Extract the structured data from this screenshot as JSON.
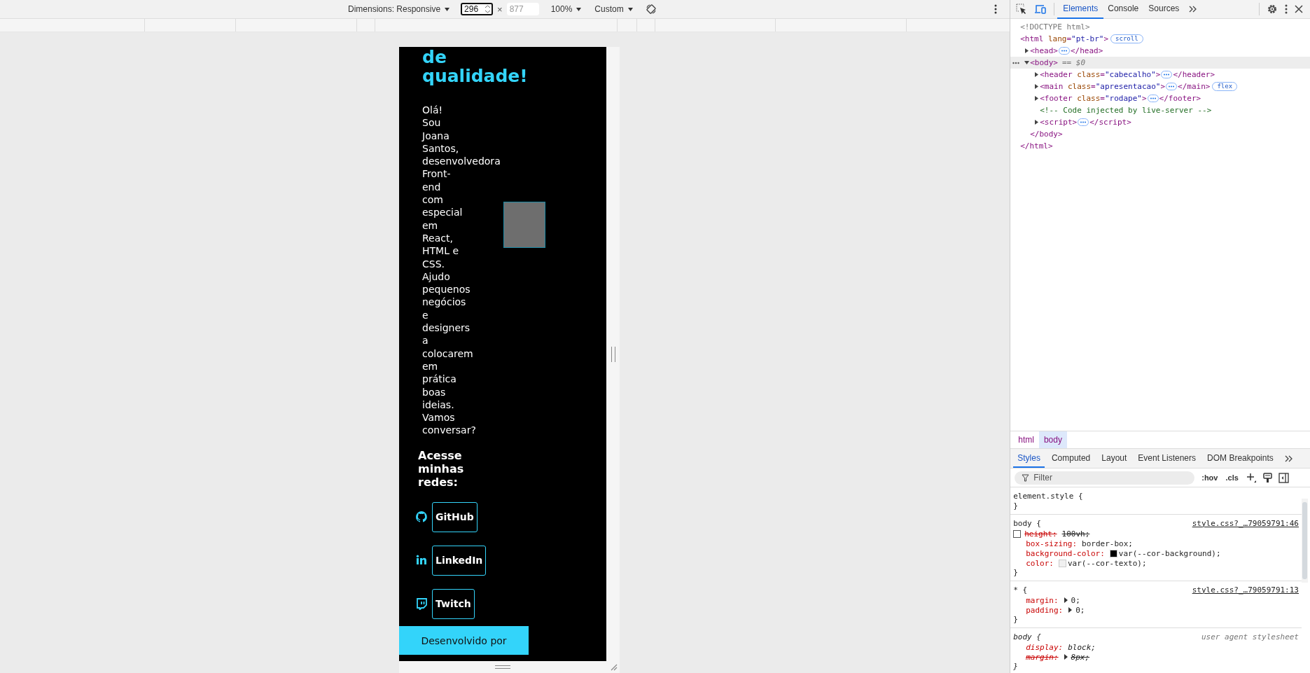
{
  "toolbar": {
    "dimensions": "Dimensions: Responsive",
    "width": {
      "value": "296",
      "focused": true
    },
    "times": "×",
    "height": {
      "placeholder": "877",
      "focused": false
    },
    "zoom": "100%",
    "throttle": "Custom"
  },
  "viewport": {
    "heading": "de\nqualidade!",
    "intro": "Olá!\nSou\nJoana\nSantos,\ndesenvolvedora\nFront-\nend\ncom\nespecial\nem\nReact,\nHTML e\nCSS.\nAjudo\npequenos\nnegócios\ne\ndesigners\na\ncolocarem\nem\nprática\nboas\nideias.\nVamos\nconversar?",
    "social_heading": "Acesse\nminhas\nredes:",
    "links": [
      {
        "kind": "github",
        "label": "GitHub"
      },
      {
        "kind": "linkedin",
        "label": "LinkedIn"
      },
      {
        "kind": "twitch",
        "label": "Twitch"
      }
    ],
    "footer": "Desenvolvido por"
  },
  "devtools": {
    "tabs": [
      {
        "label": "Elements",
        "selected": true
      },
      {
        "label": "Console",
        "selected": false
      },
      {
        "label": "Sources",
        "selected": false
      }
    ],
    "dom_tree": [
      {
        "parts": [
          {
            "kind": "doctype",
            "text": "<!DOCTYPE html>"
          }
        ],
        "selected": false
      },
      {
        "parts": [
          {
            "kind": "tag",
            "text": "<html"
          },
          {
            "kind": "attr",
            "text": " lang"
          },
          {
            "kind": "tag",
            "text": "="
          },
          {
            "kind": "value",
            "text": "\"pt-br\""
          },
          {
            "kind": "tag",
            "text": ">"
          }
        ],
        "badge": "scroll",
        "selected": false,
        "closing": "</html>",
        "children": [
          {
            "parts": [
              {
                "kind": "tag",
                "text": "<head>"
              }
            ],
            "expanded": false,
            "selected": false,
            "closing": "</head>"
          },
          {
            "parts": [
              {
                "kind": "tag",
                "text": "<body>"
              }
            ],
            "expanded": true,
            "selected": true,
            "note": "== $0",
            "closing": "</body>",
            "children": [
              {
                "parts": [
                  {
                    "kind": "tag",
                    "text": "<header"
                  },
                  {
                    "kind": "attr",
                    "text": " class"
                  },
                  {
                    "kind": "tag",
                    "text": "="
                  },
                  {
                    "kind": "value",
                    "text": "\"cabecalho\""
                  },
                  {
                    "kind": "tag",
                    "text": ">"
                  }
                ],
                "expanded": false,
                "selected": false,
                "closing": "</header>"
              },
              {
                "parts": [
                  {
                    "kind": "tag",
                    "text": "<main"
                  },
                  {
                    "kind": "attr",
                    "text": " class"
                  },
                  {
                    "kind": "tag",
                    "text": "="
                  },
                  {
                    "kind": "value",
                    "text": "\"apresentacao\""
                  },
                  {
                    "kind": "tag",
                    "text": ">"
                  }
                ],
                "expanded": false,
                "selected": false,
                "closing": "</main>",
                "badge": "flex"
              },
              {
                "parts": [
                  {
                    "kind": "tag",
                    "text": "<footer"
                  },
                  {
                    "kind": "attr",
                    "text": " class"
                  },
                  {
                    "kind": "tag",
                    "text": "="
                  },
                  {
                    "kind": "value",
                    "text": "\"rodape\""
                  },
                  {
                    "kind": "tag",
                    "text": ">"
                  }
                ],
                "expanded": false,
                "selected": false,
                "closing": "</footer>"
              },
              {
                "parts": [
                  {
                    "kind": "comment",
                    "text": "<!-- Code injected by live-server -->"
                  }
                ],
                "selected": false
              },
              {
                "parts": [
                  {
                    "kind": "tag",
                    "text": "<script>"
                  }
                ],
                "expanded": false,
                "selected": false,
                "closing": "</script>"
              }
            ]
          }
        ]
      }
    ],
    "breadcrumbs": [
      {
        "label": "html",
        "selected": false
      },
      {
        "label": "body",
        "selected": true
      }
    ],
    "style_tabs": [
      {
        "label": "Styles",
        "selected": true
      },
      {
        "label": "Computed",
        "selected": false
      },
      {
        "label": "Layout",
        "selected": false
      },
      {
        "label": "Event Listeners",
        "selected": false
      },
      {
        "label": "DOM Breakpoints",
        "selected": false
      }
    ],
    "filter": {
      "placeholder": "Filter"
    },
    "filter_buttons": [
      ":hov",
      ".cls"
    ],
    "rules": [
      {
        "kind": "author",
        "selector": "element.style {",
        "close": "}"
      },
      {
        "kind": "author",
        "selector": "body {",
        "source": "style.css?_…79059791:46",
        "close": "}",
        "declarations": [
          {
            "property": "height:",
            "value": "100vh;",
            "overridden": true,
            "checked": false,
            "expandable": false
          },
          {
            "property": "box-sizing:",
            "value": "border-box;",
            "overridden": false,
            "expandable": false
          },
          {
            "property": "background-color:",
            "value": "var(--cor-background);",
            "color": "#000000",
            "overridden": false,
            "expandable": false
          },
          {
            "property": "color:",
            "value": "var(--cor-texto);",
            "color": "#f0f0f0",
            "overridden": false,
            "expandable": false
          }
        ]
      },
      {
        "kind": "author",
        "selector": "* {",
        "source": "style.css?_…79059791:13",
        "close": "}",
        "declarations": [
          {
            "property": "margin:",
            "value": "0;",
            "overridden": false,
            "expandable": true
          },
          {
            "property": "padding:",
            "value": "0;",
            "overridden": false,
            "expandable": true
          }
        ]
      },
      {
        "kind": "user-agent",
        "selector": "body {",
        "source": "user agent stylesheet",
        "close": "}",
        "declarations": [
          {
            "property": "display:",
            "value": "block;",
            "overridden": false,
            "expandable": false
          },
          {
            "property": "margin:",
            "value": "8px;",
            "overridden": true,
            "expandable": true
          }
        ]
      }
    ]
  }
}
